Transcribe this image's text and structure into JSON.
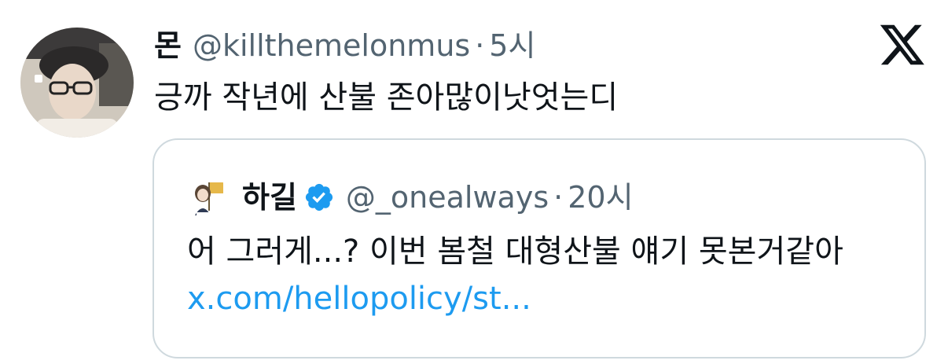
{
  "tweet": {
    "display_name": "몬",
    "handle": "@killthemelonmus",
    "separator": "·",
    "time": "5시",
    "text": "긍까 작년에 산불 존아많이낫엇는디",
    "avatar_icon": "user-avatar-photo",
    "platform_icon": "x-logo-icon"
  },
  "quote": {
    "display_name": "하길",
    "verified_icon": "verified-badge-icon",
    "verified_color": "#1d9bf0",
    "handle": "@_onealways",
    "separator": "·",
    "time": "20시",
    "text": "어 그러게...? 이번 봄철 대형산불 얘기 못본거같아 ",
    "link_text": "x.com/hellopolicy/st...",
    "avatar_icon": "illustrated-avatar"
  },
  "colors": {
    "text_primary": "#0f1419",
    "text_secondary": "#536471",
    "link": "#1d9bf0",
    "border": "#cfd9de"
  }
}
